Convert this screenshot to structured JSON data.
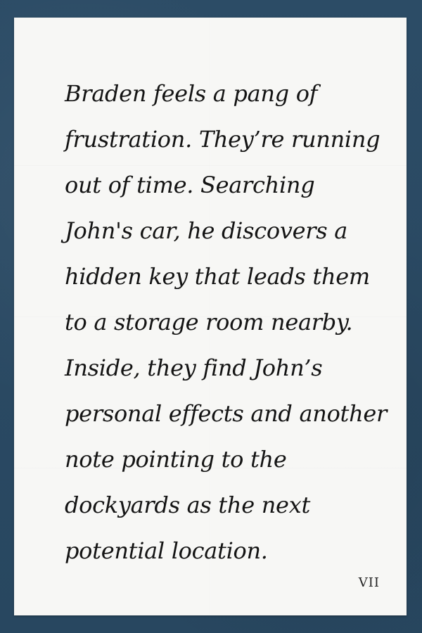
{
  "page": {
    "lines": [
      "Braden feels a pang of",
      "frustration. They’re running",
      "out of time. Searching",
      "John's car, he discovers a",
      "hidden key that leads them",
      "to a storage room nearby.",
      "Inside, they find John’s",
      "personal effects and another",
      "note pointing to the",
      "dockyards as the next",
      "potential location."
    ],
    "page_number": "VII"
  },
  "colors": {
    "background": "#2a4a63",
    "paper": "#f7f7f5",
    "ink": "#141414"
  }
}
